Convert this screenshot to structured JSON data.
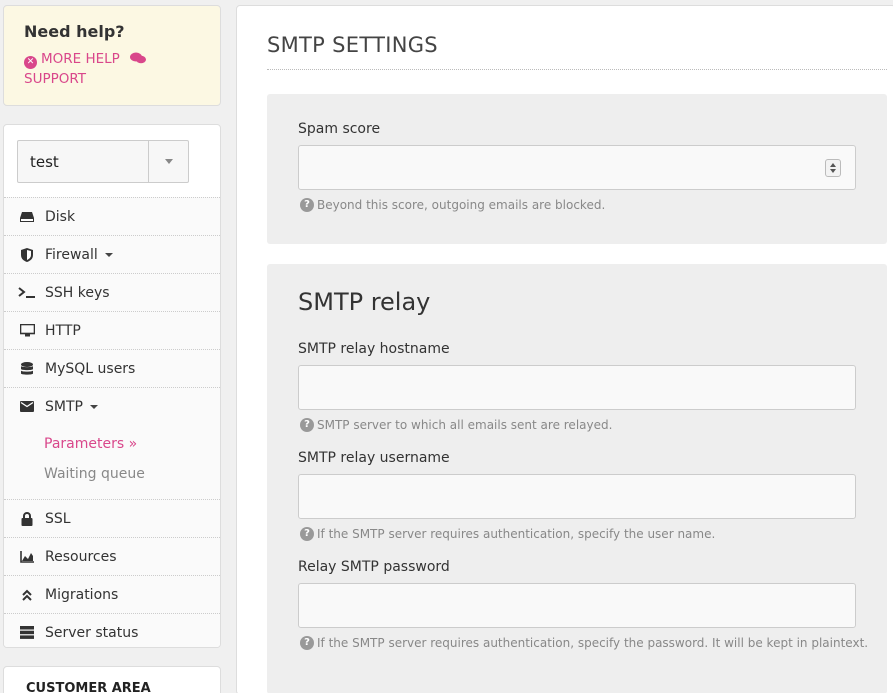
{
  "help": {
    "title": "Need help?",
    "more_help": "MORE HELP",
    "support": "SUPPORT"
  },
  "server_select": {
    "value": "test"
  },
  "nav": {
    "disk": "Disk",
    "firewall": "Firewall",
    "ssh_keys": "SSH keys",
    "http": "HTTP",
    "mysql_users": "MySQL users",
    "smtp": "SMTP",
    "smtp_sub": {
      "parameters": "Parameters »",
      "waiting_queue": "Waiting queue"
    },
    "ssl": "SSL",
    "resources": "Resources",
    "migrations": "Migrations",
    "server_status": "Server status"
  },
  "customer_area": {
    "title": "CUSTOMER AREA"
  },
  "main": {
    "title": "SMTP SETTINGS",
    "spam": {
      "label": "Spam score",
      "value": "",
      "hint": "Beyond this score, outgoing emails are blocked."
    },
    "relay": {
      "title": "SMTP relay",
      "hostname_label": "SMTP relay hostname",
      "hostname_value": "",
      "hostname_hint": "SMTP server to which all emails sent are relayed.",
      "username_label": "SMTP relay username",
      "username_value": "",
      "username_hint": "If the SMTP server requires authentication, specify the user name.",
      "password_label": "Relay SMTP password",
      "password_value": "",
      "password_hint": "If the SMTP server requires authentication, specify the password. It will be kept in plaintext."
    }
  },
  "colors": {
    "accent": "#d9478b",
    "help_bg": "#fcf8e3",
    "panel_bg": "#eeeeee"
  }
}
